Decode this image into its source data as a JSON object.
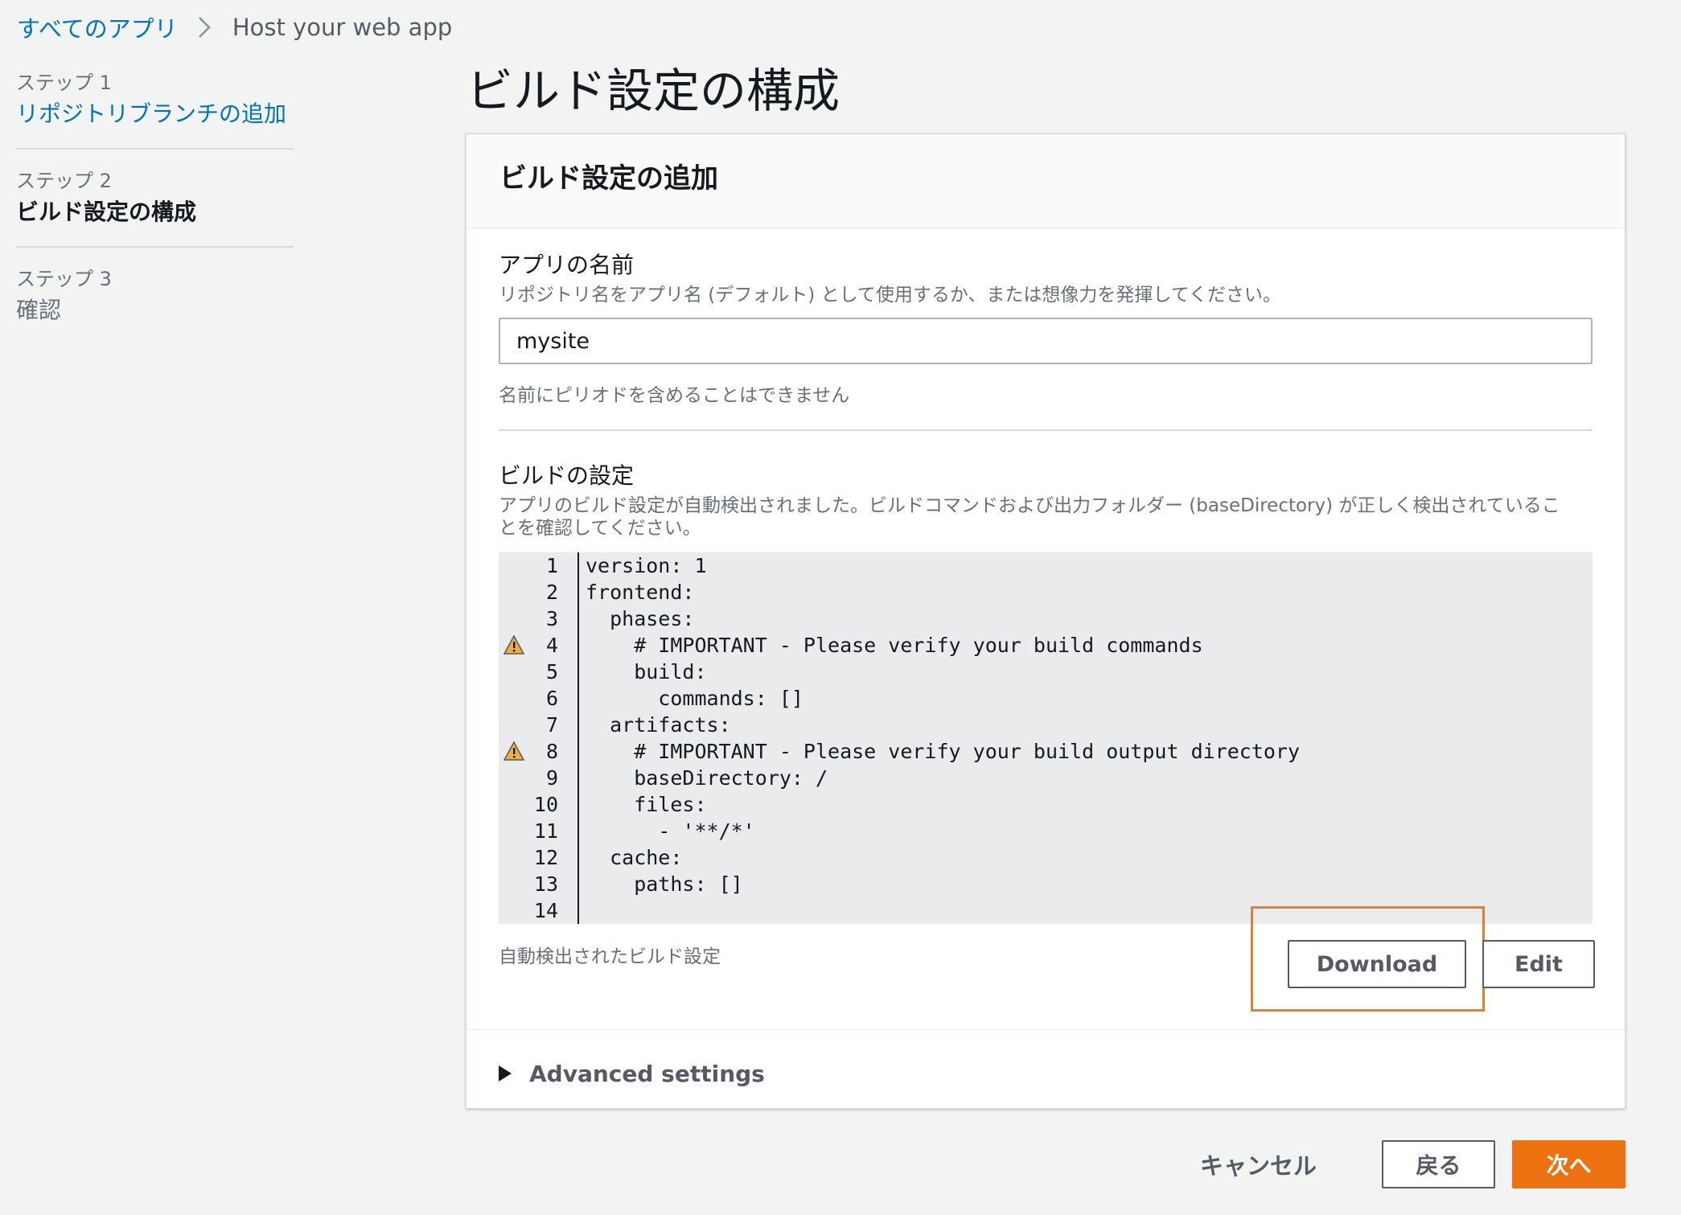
{
  "breadcrumb": {
    "home": "すべてのアプリ",
    "current": "Host your web app",
    "separator_icon": "chevron-right-icon"
  },
  "steps": [
    {
      "number": "ステップ 1",
      "label": "リポジトリブランチの追加",
      "state": "link"
    },
    {
      "number": "ステップ 2",
      "label": "ビルド設定の構成",
      "state": "active"
    },
    {
      "number": "ステップ 3",
      "label": "確認",
      "state": "disabled"
    }
  ],
  "page": {
    "title": "ビルド設定の構成"
  },
  "panel": {
    "title": "ビルド設定の追加"
  },
  "app_name": {
    "label": "アプリの名前",
    "description": "リポジトリ名をアプリ名 (デフォルト) として使用するか、または想像力を発揮してください。",
    "value": "mysite",
    "hint": "名前にピリオドを含めることはできません"
  },
  "build_settings": {
    "label": "ビルドの設定",
    "description_line1": "アプリのビルド設定が自動検出されました。ビルドコマンドおよび出力フォルダー (baseDirectory) が正しく検出されているこ",
    "description_line2": "とを確認してください。",
    "caption": "自動検出されたビルド設定",
    "warning_icon": "warning-icon",
    "code_lines": [
      {
        "num": "1",
        "text": "version: 1",
        "warning": false
      },
      {
        "num": "2",
        "text": "frontend:",
        "warning": false
      },
      {
        "num": "3",
        "text": "  phases:",
        "warning": false
      },
      {
        "num": "4",
        "text": "    # IMPORTANT - Please verify your build commands",
        "warning": true
      },
      {
        "num": "5",
        "text": "    build:",
        "warning": false
      },
      {
        "num": "6",
        "text": "      commands: []",
        "warning": false
      },
      {
        "num": "7",
        "text": "  artifacts:",
        "warning": false
      },
      {
        "num": "8",
        "text": "    # IMPORTANT - Please verify your build output directory",
        "warning": true
      },
      {
        "num": "9",
        "text": "    baseDirectory: /",
        "warning": false
      },
      {
        "num": "10",
        "text": "    files:",
        "warning": false
      },
      {
        "num": "11",
        "text": "      - '**/*'",
        "warning": false
      },
      {
        "num": "12",
        "text": "  cache:",
        "warning": false
      },
      {
        "num": "13",
        "text": "    paths: []",
        "warning": false
      },
      {
        "num": "14",
        "text": "",
        "warning": false
      }
    ],
    "download_label": "Download",
    "edit_label": "Edit",
    "highlight_color": "#ef7b27"
  },
  "advanced": {
    "label": "Advanced settings",
    "icon": "caret-right-icon"
  },
  "footer": {
    "cancel_label": "キャンセル",
    "back_label": "戻る",
    "next_label": "次へ",
    "primary_color": "#ec7211"
  },
  "colors": {
    "link": "#0073bb",
    "background": "#f2f3f3",
    "text_secondary": "#687078"
  }
}
